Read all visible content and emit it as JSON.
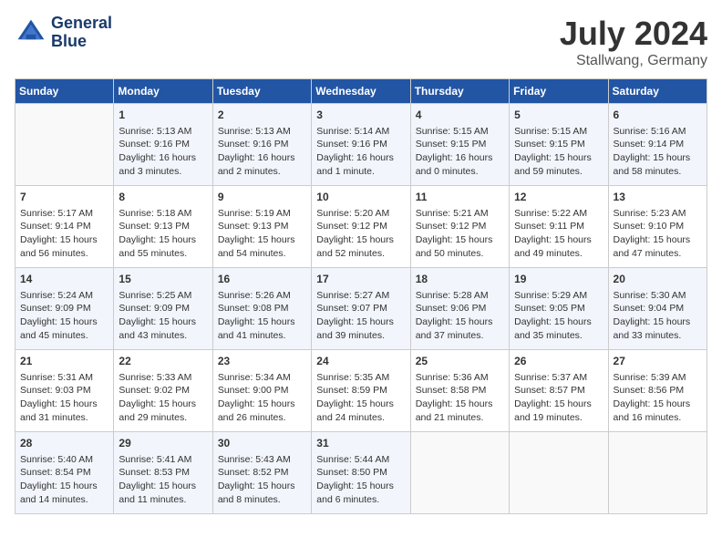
{
  "header": {
    "logo_line1": "General",
    "logo_line2": "Blue",
    "month_title": "July 2024",
    "location": "Stallwang, Germany"
  },
  "days_of_week": [
    "Sunday",
    "Monday",
    "Tuesday",
    "Wednesday",
    "Thursday",
    "Friday",
    "Saturday"
  ],
  "weeks": [
    [
      {
        "day": "",
        "content": ""
      },
      {
        "day": "1",
        "content": "Sunrise: 5:13 AM\nSunset: 9:16 PM\nDaylight: 16 hours\nand 3 minutes."
      },
      {
        "day": "2",
        "content": "Sunrise: 5:13 AM\nSunset: 9:16 PM\nDaylight: 16 hours\nand 2 minutes."
      },
      {
        "day": "3",
        "content": "Sunrise: 5:14 AM\nSunset: 9:16 PM\nDaylight: 16 hours\nand 1 minute."
      },
      {
        "day": "4",
        "content": "Sunrise: 5:15 AM\nSunset: 9:15 PM\nDaylight: 16 hours\nand 0 minutes."
      },
      {
        "day": "5",
        "content": "Sunrise: 5:15 AM\nSunset: 9:15 PM\nDaylight: 15 hours\nand 59 minutes."
      },
      {
        "day": "6",
        "content": "Sunrise: 5:16 AM\nSunset: 9:14 PM\nDaylight: 15 hours\nand 58 minutes."
      }
    ],
    [
      {
        "day": "7",
        "content": "Sunrise: 5:17 AM\nSunset: 9:14 PM\nDaylight: 15 hours\nand 56 minutes."
      },
      {
        "day": "8",
        "content": "Sunrise: 5:18 AM\nSunset: 9:13 PM\nDaylight: 15 hours\nand 55 minutes."
      },
      {
        "day": "9",
        "content": "Sunrise: 5:19 AM\nSunset: 9:13 PM\nDaylight: 15 hours\nand 54 minutes."
      },
      {
        "day": "10",
        "content": "Sunrise: 5:20 AM\nSunset: 9:12 PM\nDaylight: 15 hours\nand 52 minutes."
      },
      {
        "day": "11",
        "content": "Sunrise: 5:21 AM\nSunset: 9:12 PM\nDaylight: 15 hours\nand 50 minutes."
      },
      {
        "day": "12",
        "content": "Sunrise: 5:22 AM\nSunset: 9:11 PM\nDaylight: 15 hours\nand 49 minutes."
      },
      {
        "day": "13",
        "content": "Sunrise: 5:23 AM\nSunset: 9:10 PM\nDaylight: 15 hours\nand 47 minutes."
      }
    ],
    [
      {
        "day": "14",
        "content": "Sunrise: 5:24 AM\nSunset: 9:09 PM\nDaylight: 15 hours\nand 45 minutes."
      },
      {
        "day": "15",
        "content": "Sunrise: 5:25 AM\nSunset: 9:09 PM\nDaylight: 15 hours\nand 43 minutes."
      },
      {
        "day": "16",
        "content": "Sunrise: 5:26 AM\nSunset: 9:08 PM\nDaylight: 15 hours\nand 41 minutes."
      },
      {
        "day": "17",
        "content": "Sunrise: 5:27 AM\nSunset: 9:07 PM\nDaylight: 15 hours\nand 39 minutes."
      },
      {
        "day": "18",
        "content": "Sunrise: 5:28 AM\nSunset: 9:06 PM\nDaylight: 15 hours\nand 37 minutes."
      },
      {
        "day": "19",
        "content": "Sunrise: 5:29 AM\nSunset: 9:05 PM\nDaylight: 15 hours\nand 35 minutes."
      },
      {
        "day": "20",
        "content": "Sunrise: 5:30 AM\nSunset: 9:04 PM\nDaylight: 15 hours\nand 33 minutes."
      }
    ],
    [
      {
        "day": "21",
        "content": "Sunrise: 5:31 AM\nSunset: 9:03 PM\nDaylight: 15 hours\nand 31 minutes."
      },
      {
        "day": "22",
        "content": "Sunrise: 5:33 AM\nSunset: 9:02 PM\nDaylight: 15 hours\nand 29 minutes."
      },
      {
        "day": "23",
        "content": "Sunrise: 5:34 AM\nSunset: 9:00 PM\nDaylight: 15 hours\nand 26 minutes."
      },
      {
        "day": "24",
        "content": "Sunrise: 5:35 AM\nSunset: 8:59 PM\nDaylight: 15 hours\nand 24 minutes."
      },
      {
        "day": "25",
        "content": "Sunrise: 5:36 AM\nSunset: 8:58 PM\nDaylight: 15 hours\nand 21 minutes."
      },
      {
        "day": "26",
        "content": "Sunrise: 5:37 AM\nSunset: 8:57 PM\nDaylight: 15 hours\nand 19 minutes."
      },
      {
        "day": "27",
        "content": "Sunrise: 5:39 AM\nSunset: 8:56 PM\nDaylight: 15 hours\nand 16 minutes."
      }
    ],
    [
      {
        "day": "28",
        "content": "Sunrise: 5:40 AM\nSunset: 8:54 PM\nDaylight: 15 hours\nand 14 minutes."
      },
      {
        "day": "29",
        "content": "Sunrise: 5:41 AM\nSunset: 8:53 PM\nDaylight: 15 hours\nand 11 minutes."
      },
      {
        "day": "30",
        "content": "Sunrise: 5:43 AM\nSunset: 8:52 PM\nDaylight: 15 hours\nand 8 minutes."
      },
      {
        "day": "31",
        "content": "Sunrise: 5:44 AM\nSunset: 8:50 PM\nDaylight: 15 hours\nand 6 minutes."
      },
      {
        "day": "",
        "content": ""
      },
      {
        "day": "",
        "content": ""
      },
      {
        "day": "",
        "content": ""
      }
    ]
  ]
}
